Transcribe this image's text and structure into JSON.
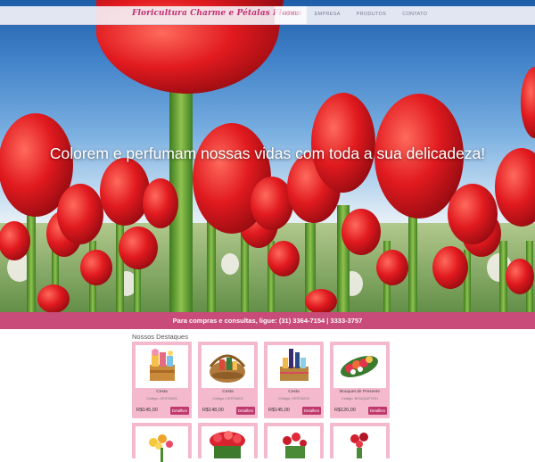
{
  "site": {
    "logo_text": "Floricultura Charme e Pétalas Flores",
    "nav": [
      {
        "label": "Home",
        "active": true
      },
      {
        "label": "Empresa",
        "active": false
      },
      {
        "label": "Produtos",
        "active": false
      },
      {
        "label": "Contato",
        "active": false
      }
    ]
  },
  "hero": {
    "headline": "Colorem e perfumam nossas vidas com toda a sua delicadeza!"
  },
  "contact": {
    "text": "Para compras e consultas, ligue: (31) 3364-7154 | 3333-3757"
  },
  "featured": {
    "title": "Nossos Destaques",
    "products": [
      {
        "name": "Cesta",
        "code": "Código: CESTA001",
        "price": "R$145,00",
        "details_label": "Detalhes",
        "thumb_icon": "gift-basket-image"
      },
      {
        "name": "Cesta",
        "code": "Código: CESTA002",
        "price": "R$148,00",
        "details_label": "Detalhes",
        "thumb_icon": "wicker-basket-image"
      },
      {
        "name": "Cesta",
        "code": "Código: CESTA003",
        "price": "R$145,00",
        "details_label": "Detalhes",
        "thumb_icon": "bottle-basket-image"
      },
      {
        "name": "Bouquet de Presente",
        "code": "Código: BOUQUET001",
        "price": "R$120,00",
        "details_label": "Detalhes",
        "thumb_icon": "bouquet-image"
      }
    ],
    "partial_row_icons": [
      "yellow-flowers-image",
      "red-flowers-image",
      "red-roses-image",
      "red-roses-image"
    ]
  },
  "colors": {
    "brand_pink": "#c84b79",
    "card_pink": "#f4b9cc",
    "button_pink": "#c13a6e",
    "logo_pink": "#c32f74"
  }
}
